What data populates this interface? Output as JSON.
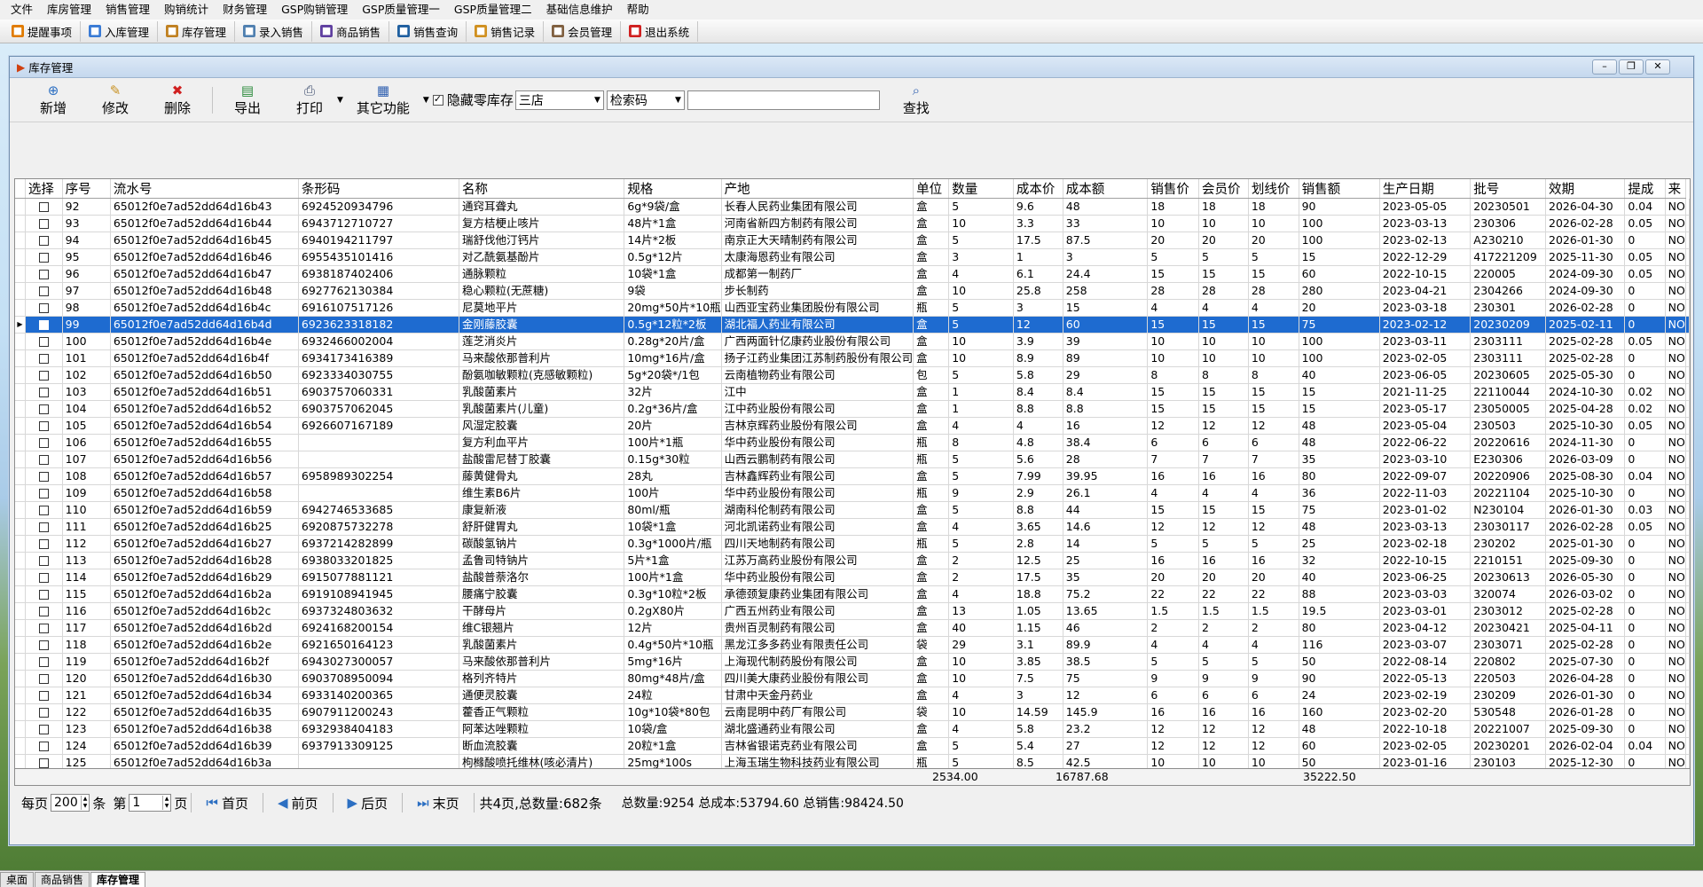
{
  "menu": [
    "文件",
    "库房管理",
    "销售管理",
    "购销统计",
    "财务管理",
    "GSP购销管理",
    "GSP质量管理一",
    "GSP质量管理二",
    "基础信息维护",
    "帮助"
  ],
  "toolbar": [
    {
      "label": "提醒事项",
      "icon": "reminder-icon",
      "color": "#e07b00"
    },
    {
      "label": "入库管理",
      "icon": "stock-in-icon",
      "color": "#3a7bd5"
    },
    {
      "label": "库存管理",
      "icon": "inventory-icon",
      "color": "#c08020"
    },
    {
      "label": "录入销售",
      "icon": "sales-entry-icon",
      "color": "#5080b0"
    },
    {
      "label": "商品销售",
      "icon": "product-sales-icon",
      "color": "#6040a0"
    },
    {
      "label": "销售查询",
      "icon": "sales-query-icon",
      "color": "#2060a0"
    },
    {
      "label": "销售记录",
      "icon": "sales-record-icon",
      "color": "#d09020"
    },
    {
      "label": "会员管理",
      "icon": "member-icon",
      "color": "#806040"
    },
    {
      "label": "退出系统",
      "icon": "exit-icon",
      "color": "#d02020"
    }
  ],
  "window": {
    "title": "库存管理"
  },
  "actions": {
    "add": "新增",
    "edit": "修改",
    "delete": "删除",
    "export": "导出",
    "print": "打印",
    "other": "其它功能",
    "hide_zero": "隐藏零库存",
    "store": "三店",
    "search_type": "检索码",
    "search_value": "",
    "search_btn": "查找"
  },
  "columns": [
    "选择",
    "序号",
    "流水号",
    "条形码",
    "名称",
    "规格",
    "产地",
    "单位",
    "数量",
    "成本价",
    "成本额",
    "销售价",
    "会员价",
    "划线价",
    "销售额",
    "生产日期",
    "批号",
    "效期",
    "提成",
    "来"
  ],
  "rows": [
    [
      "92",
      "65012f0e7ad52dd64d16b43",
      "6924520934796",
      "通窍耳聋丸",
      "6g*9袋/盒",
      "长春人民药业集团有限公司",
      "盒",
      "5",
      "9.6",
      "48",
      "18",
      "18",
      "18",
      "90",
      "2023-05-05",
      "20230501",
      "2026-04-30",
      "0.04",
      "NO"
    ],
    [
      "93",
      "65012f0e7ad52dd64d16b44",
      "6943712710727",
      "复方桔梗止咳片",
      "48片*1盒",
      "河南省新四方制药有限公司",
      "盒",
      "10",
      "3.3",
      "33",
      "10",
      "10",
      "10",
      "100",
      "2023-03-13",
      "230306",
      "2026-02-28",
      "0.05",
      "NO"
    ],
    [
      "94",
      "65012f0e7ad52dd64d16b45",
      "6940194211797",
      "瑞舒伐他汀钙片",
      "14片*2板",
      "南京正大天晴制药有限公司",
      "盒",
      "5",
      "17.5",
      "87.5",
      "20",
      "20",
      "20",
      "100",
      "2023-02-13",
      "A230210",
      "2026-01-30",
      "0",
      "NO"
    ],
    [
      "95",
      "65012f0e7ad52dd64d16b46",
      "6955435101416",
      "对乙酰氨基酚片",
      "0.5g*12片",
      "太康海恩药业有限公司",
      "盒",
      "3",
      "1",
      "3",
      "5",
      "5",
      "5",
      "15",
      "2022-12-29",
      "417221209",
      "2025-11-30",
      "0.05",
      "NO"
    ],
    [
      "96",
      "65012f0e7ad52dd64d16b47",
      "6938187402406",
      "通脉颗粒",
      "10袋*1盒",
      "成都第一制药厂",
      "盒",
      "4",
      "6.1",
      "24.4",
      "15",
      "15",
      "15",
      "60",
      "2022-10-15",
      "220005",
      "2024-09-30",
      "0.05",
      "NO"
    ],
    [
      "97",
      "65012f0e7ad52dd64d16b48",
      "6927762130384",
      "稳心颗粒(无蔗糖)",
      "9袋",
      "步长制药",
      "盒",
      "10",
      "25.8",
      "258",
      "28",
      "28",
      "28",
      "280",
      "2023-04-21",
      "2304266",
      "2024-09-30",
      "0",
      "NO"
    ],
    [
      "98",
      "65012f0e7ad52dd64d16b4c",
      "6916107517126",
      "尼莫地平片",
      "20mg*50片*10瓶",
      "山西亚宝药业集团股份有限公司",
      "瓶",
      "5",
      "3",
      "15",
      "4",
      "4",
      "4",
      "20",
      "2023-03-18",
      "230301",
      "2026-02-28",
      "0",
      "NO"
    ],
    [
      "99",
      "65012f0e7ad52dd64d16b4d",
      "6923623318182",
      "金刚藤胶囊",
      "0.5g*12粒*2板",
      "湖北福人药业有限公司",
      "盒",
      "5",
      "12",
      "60",
      "15",
      "15",
      "15",
      "75",
      "2023-02-12",
      "20230209",
      "2025-02-11",
      "0",
      "NO"
    ],
    [
      "100",
      "65012f0e7ad52dd64d16b4e",
      "6932466002004",
      "莲芝消炎片",
      "0.28g*20片/盒",
      "广西两面针亿康药业股份有限公司",
      "盒",
      "10",
      "3.9",
      "39",
      "10",
      "10",
      "10",
      "100",
      "2023-03-11",
      "2303111",
      "2025-02-28",
      "0.05",
      "NO"
    ],
    [
      "101",
      "65012f0e7ad52dd64d16b4f",
      "6934173416389",
      "马来酸依那普利片",
      "10mg*16片/盒",
      "扬子江药业集团江苏制药股份有限公司",
      "盒",
      "10",
      "8.9",
      "89",
      "10",
      "10",
      "10",
      "100",
      "2023-02-05",
      "2303111",
      "2025-02-28",
      "0",
      "NO"
    ],
    [
      "102",
      "65012f0e7ad52dd64d16b50",
      "6923334030755",
      "酚氨咖敏颗粒(克感敏颗粒)",
      "5g*20袋*/1包",
      "云南植物药业有限公司",
      "包",
      "5",
      "5.8",
      "29",
      "8",
      "8",
      "8",
      "40",
      "2023-06-05",
      "20230605",
      "2025-05-30",
      "0",
      "NO"
    ],
    [
      "103",
      "65012f0e7ad52dd64d16b51",
      "6903757060331",
      "乳酸菌素片",
      "32片",
      "江中",
      "盒",
      "1",
      "8.4",
      "8.4",
      "15",
      "15",
      "15",
      "15",
      "2021-11-25",
      "22110044",
      "2024-10-30",
      "0.02",
      "NO"
    ],
    [
      "104",
      "65012f0e7ad52dd64d16b52",
      "6903757062045",
      "乳酸菌素片(儿童)",
      "0.2g*36片/盒",
      "江中药业股份有限公司",
      "盒",
      "1",
      "8.8",
      "8.8",
      "15",
      "15",
      "15",
      "15",
      "2023-05-17",
      "23050005",
      "2025-04-28",
      "0.02",
      "NO"
    ],
    [
      "105",
      "65012f0e7ad52dd64d16b54",
      "6926607167189",
      "风湿定胶囊",
      "20片",
      "吉林京辉药业股份有限公司",
      "盒",
      "4",
      "4",
      "16",
      "12",
      "12",
      "12",
      "48",
      "2023-05-04",
      "230503",
      "2025-10-30",
      "0.05",
      "NO"
    ],
    [
      "106",
      "65012f0e7ad52dd64d16b55",
      "",
      "复方利血平片",
      "100片*1瓶",
      "华中药业股份有限公司",
      "瓶",
      "8",
      "4.8",
      "38.4",
      "6",
      "6",
      "6",
      "48",
      "2022-06-22",
      "20220616",
      "2024-11-30",
      "0",
      "NO"
    ],
    [
      "107",
      "65012f0e7ad52dd64d16b56",
      "",
      "盐酸雷尼替丁胶囊",
      "0.15g*30粒",
      "山西云鹏制药有限公司",
      "瓶",
      "5",
      "5.6",
      "28",
      "7",
      "7",
      "7",
      "35",
      "2023-03-10",
      "E230306",
      "2026-03-09",
      "0",
      "NO"
    ],
    [
      "108",
      "65012f0e7ad52dd64d16b57",
      "6958989302254",
      "藤黄健骨丸",
      "28丸",
      "吉林鑫辉药业有限公司",
      "盒",
      "5",
      "7.99",
      "39.95",
      "16",
      "16",
      "16",
      "80",
      "2022-09-07",
      "20220906",
      "2025-08-30",
      "0.04",
      "NO"
    ],
    [
      "109",
      "65012f0e7ad52dd64d16b58",
      "",
      "维生素B6片",
      "100片",
      "华中药业股份有限公司",
      "瓶",
      "9",
      "2.9",
      "26.1",
      "4",
      "4",
      "4",
      "36",
      "2022-11-03",
      "20221104",
      "2025-10-30",
      "0",
      "NO"
    ],
    [
      "110",
      "65012f0e7ad52dd64d16b59",
      "6942746533685",
      "康复新液",
      "80ml/瓶",
      "湖南科伦制药有限公司",
      "盒",
      "5",
      "8.8",
      "44",
      "15",
      "15",
      "15",
      "75",
      "2023-01-02",
      "N230104",
      "2026-01-30",
      "0.03",
      "NO"
    ],
    [
      "111",
      "65012f0e7ad52dd64d16b25",
      "6920875732278",
      "舒肝健胃丸",
      "10袋*1盒",
      "河北凯诺药业有限公司",
      "盒",
      "4",
      "3.65",
      "14.6",
      "12",
      "12",
      "12",
      "48",
      "2023-03-13",
      "23030117",
      "2026-02-28",
      "0.05",
      "NO"
    ],
    [
      "112",
      "65012f0e7ad52dd64d16b27",
      "6937214282899",
      "碳酸氢钠片",
      "0.3g*1000片/瓶",
      "四川天地制药有限公司",
      "瓶",
      "5",
      "2.8",
      "14",
      "5",
      "5",
      "5",
      "25",
      "2023-02-18",
      "230202",
      "2025-01-30",
      "0",
      "NO"
    ],
    [
      "113",
      "65012f0e7ad52dd64d16b28",
      "6938033201825",
      "孟鲁司特钠片",
      "5片*1盒",
      "江苏万高药业股份有限公司",
      "盒",
      "2",
      "12.5",
      "25",
      "16",
      "16",
      "16",
      "32",
      "2022-10-15",
      "2210151",
      "2025-09-30",
      "0",
      "NO"
    ],
    [
      "114",
      "65012f0e7ad52dd64d16b29",
      "6915077881121",
      "盐酸普萘洛尔",
      "100片*1盒",
      "华中药业股份有限公司",
      "盒",
      "2",
      "17.5",
      "35",
      "20",
      "20",
      "20",
      "40",
      "2023-06-25",
      "20230613",
      "2026-05-30",
      "0",
      "NO"
    ],
    [
      "115",
      "65012f0e7ad52dd64d16b2a",
      "6919108941945",
      "腰痛宁胶囊",
      "0.3g*10粒*2板",
      "承德颈复康药业集团有限公司",
      "盒",
      "4",
      "18.8",
      "75.2",
      "22",
      "22",
      "22",
      "88",
      "2023-03-03",
      "320074",
      "2026-03-02",
      "0",
      "NO"
    ],
    [
      "116",
      "65012f0e7ad52dd64d16b2c",
      "6937324803632",
      "干酵母片",
      "0.2gX80片",
      "广西五州药业有限公司",
      "盒",
      "13",
      "1.05",
      "13.65",
      "1.5",
      "1.5",
      "1.5",
      "19.5",
      "2023-03-01",
      "2303012",
      "2025-02-28",
      "0",
      "NO"
    ],
    [
      "117",
      "65012f0e7ad52dd64d16b2d",
      "6924168200154",
      "维C银翘片",
      "12片",
      "贵州百灵制药有限公司",
      "盒",
      "40",
      "1.15",
      "46",
      "2",
      "2",
      "2",
      "80",
      "2023-04-12",
      "20230421",
      "2025-04-11",
      "0",
      "NO"
    ],
    [
      "118",
      "65012f0e7ad52dd64d16b2e",
      "6921650164123",
      "乳酸菌素片",
      "0.4g*50片*10瓶",
      "黑龙江多多药业有限责任公司",
      "袋",
      "29",
      "3.1",
      "89.9",
      "4",
      "4",
      "4",
      "116",
      "2023-03-07",
      "2303071",
      "2025-02-28",
      "0",
      "NO"
    ],
    [
      "119",
      "65012f0e7ad52dd64d16b2f",
      "6943027300057",
      "马来酸依那普利片",
      "5mg*16片",
      "上海现代制药股份有限公司",
      "盒",
      "10",
      "3.85",
      "38.5",
      "5",
      "5",
      "5",
      "50",
      "2022-08-14",
      "220802",
      "2025-07-30",
      "0",
      "NO"
    ],
    [
      "120",
      "65012f0e7ad52dd64d16b30",
      "6903708950094",
      "格列齐特片",
      "80mg*48片/盒",
      "四川美大康药业股份有限公司",
      "盒",
      "10",
      "7.5",
      "75",
      "9",
      "9",
      "9",
      "90",
      "2022-05-13",
      "220503",
      "2026-04-28",
      "0",
      "NO"
    ],
    [
      "121",
      "65012f0e7ad52dd64d16b34",
      "6933140200365",
      "通便灵胶囊",
      "24粒",
      "甘肃中天金丹药业",
      "盒",
      "4",
      "3",
      "12",
      "6",
      "6",
      "6",
      "24",
      "2023-02-19",
      "230209",
      "2026-01-30",
      "0",
      "NO"
    ],
    [
      "122",
      "65012f0e7ad52dd64d16b35",
      "6907911200243",
      "藿香正气颗粒",
      "10g*10袋*80包",
      "云南昆明中药厂有限公司",
      "袋",
      "10",
      "14.59",
      "145.9",
      "16",
      "16",
      "16",
      "160",
      "2023-02-20",
      "530548",
      "2026-01-28",
      "0",
      "NO"
    ],
    [
      "123",
      "65012f0e7ad52dd64d16b38",
      "6932938404183",
      "阿苯达唑颗粒",
      "10袋/盒",
      "湖北盛通药业有限公司",
      "盒",
      "4",
      "5.8",
      "23.2",
      "12",
      "12",
      "12",
      "48",
      "2022-10-18",
      "20221007",
      "2025-09-30",
      "0",
      "NO"
    ],
    [
      "124",
      "65012f0e7ad52dd64d16b39",
      "6937913309125",
      "断血流胶囊",
      "20粒*1盒",
      "吉林省银诺克药业有限公司",
      "盒",
      "5",
      "5.4",
      "27",
      "12",
      "12",
      "12",
      "60",
      "2023-02-05",
      "20230201",
      "2026-02-04",
      "0.04",
      "NO"
    ],
    [
      "125",
      "65012f0e7ad52dd64d16b3a",
      "",
      "枸橼酸喷托维林(咳必清片)",
      "25mg*100s",
      "上海玉瑞生物科技药业有限公司",
      "瓶",
      "5",
      "8.5",
      "42.5",
      "10",
      "10",
      "10",
      "50",
      "2023-01-16",
      "230103",
      "2025-12-30",
      "0",
      "NO"
    ]
  ],
  "selected_row": 7,
  "summary": {
    "qty": "2534.00",
    "cost": "16787.68",
    "sales": "35222.50"
  },
  "pager": {
    "per_page_label": "每页",
    "per_page": "200",
    "unit": "条",
    "page_label": "第",
    "page": "1",
    "page_unit": "页",
    "first": "首页",
    "prev": "前页",
    "next": "后页",
    "last": "末页",
    "info": "共4页,总数量:682条",
    "totals": "总数量:9254 总成本:53794.60 总销售:98424.50"
  },
  "tabs": [
    "桌面",
    "商品销售",
    "库存管理"
  ],
  "active_tab": 2
}
